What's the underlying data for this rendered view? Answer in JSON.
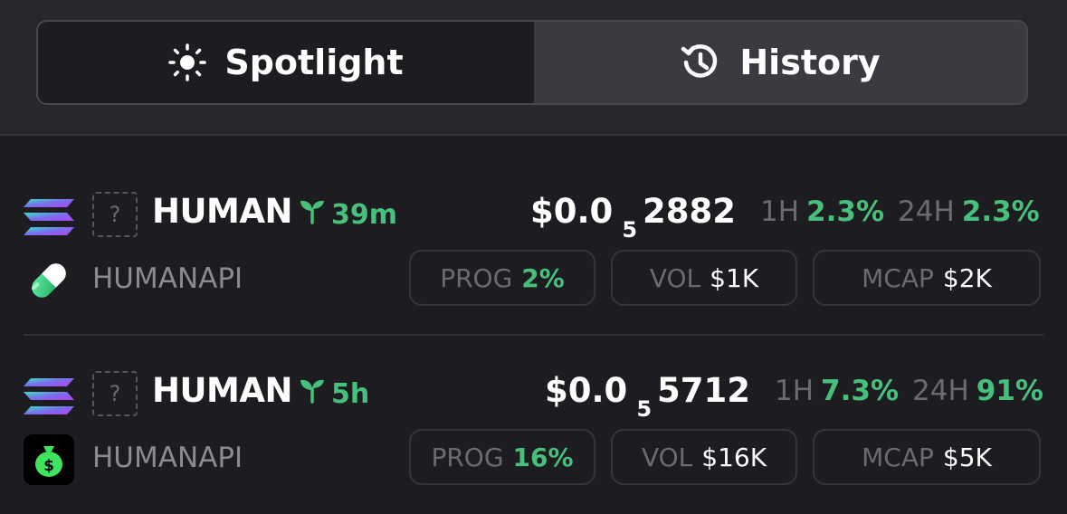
{
  "tabs": [
    {
      "label": "Spotlight",
      "icon": "sun-icon",
      "active": true
    },
    {
      "label": "History",
      "icon": "history-icon",
      "active": false
    }
  ],
  "colors": {
    "accent_green": "#46c07a",
    "muted": "#6a6a71",
    "bg": "#1c1c21"
  },
  "tokens": [
    {
      "chain_icon": "solana-icon",
      "ticker": "HUMAN",
      "age": "39m",
      "name": "HUMANAPI",
      "logo_icon": "pill-icon",
      "price": {
        "prefix": "$0.0",
        "zeros": "5",
        "digits": "2882"
      },
      "change_1h_label": "1H",
      "change_1h": "2.3%",
      "change_24h_label": "24H",
      "change_24h": "2.3%",
      "prog_label": "PROG",
      "prog": "2%",
      "vol_label": "VOL",
      "vol": "$1K",
      "mcap_label": "MCAP",
      "mcap": "$2K"
    },
    {
      "chain_icon": "solana-icon",
      "ticker": "HUMAN",
      "age": "5h",
      "name": "HUMANAPI",
      "logo_icon": "money-bag-icon",
      "price": {
        "prefix": "$0.0",
        "zeros": "5",
        "digits": "5712"
      },
      "change_1h_label": "1H",
      "change_1h": "7.3%",
      "change_24h_label": "24H",
      "change_24h": "91%",
      "prog_label": "PROG",
      "prog": "16%",
      "vol_label": "VOL",
      "vol": "$16K",
      "mcap_label": "MCAP",
      "mcap": "$5K"
    }
  ]
}
